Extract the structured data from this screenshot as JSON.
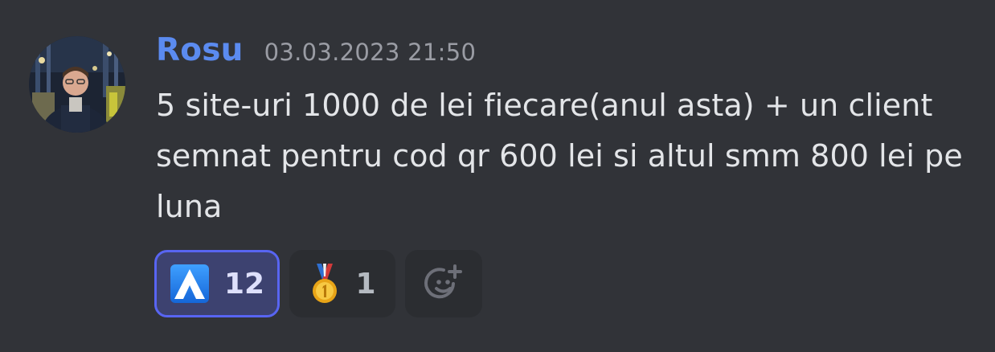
{
  "message": {
    "author": {
      "name": "Rosu",
      "avatar": "user-photo-avatar",
      "name_color": "#5b8bf0"
    },
    "timestamp": "03.03.2023 21:50",
    "content": "5 site-uri 1000 de lei fiecare(anul asta) + un client semnat pentru cod qr 600 lei si altul smm 800 lei pe luna"
  },
  "reactions": [
    {
      "emoji": "blue-a-logo-emoji",
      "count": "12",
      "active": true
    },
    {
      "emoji": "first-place-medal-emoji",
      "count": "1",
      "active": false
    }
  ],
  "add_reaction": {
    "icon": "add-reaction-smiley-icon"
  },
  "colors": {
    "background": "#313338",
    "text": "#e3e5e8",
    "timestamp": "#9a9ca4",
    "reaction_active_bg": "#3d4270",
    "reaction_active_border": "#5865f2",
    "reaction_bg": "#2b2d31"
  }
}
